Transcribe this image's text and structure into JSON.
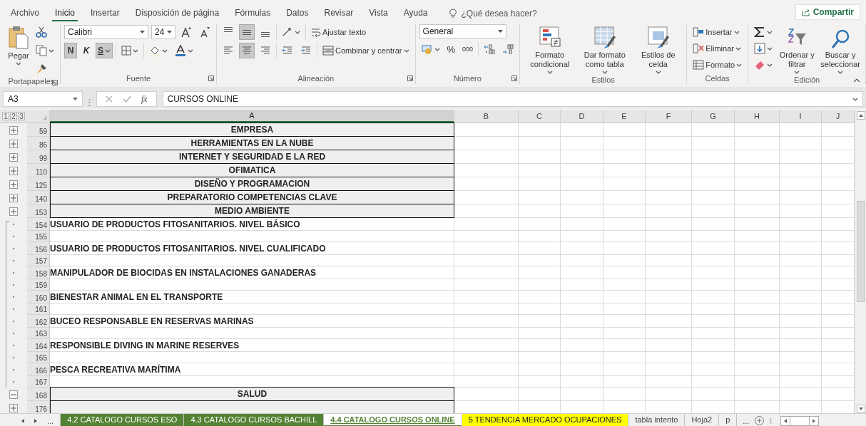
{
  "menu_tabs": [
    {
      "label": "Archivo",
      "selected": false
    },
    {
      "label": "Inicio",
      "selected": true
    },
    {
      "label": "Insertar",
      "selected": false
    },
    {
      "label": "Disposición de página",
      "selected": false
    },
    {
      "label": "Fórmulas",
      "selected": false
    },
    {
      "label": "Datos",
      "selected": false
    },
    {
      "label": "Revisar",
      "selected": false
    },
    {
      "label": "Vista",
      "selected": false
    },
    {
      "label": "Ayuda",
      "selected": false
    }
  ],
  "tell_me": {
    "placeholder": "¿Qué desea hacer?"
  },
  "share_button": "Compartir",
  "ribbon": {
    "clipboard": {
      "label": "Portapapeles",
      "paste": "Pegar"
    },
    "font": {
      "label": "Fuente",
      "font_name": "Calibri",
      "font_size": "24",
      "bold_key": "N",
      "italic_key": "K",
      "underline_key": "S",
      "bold": true,
      "italic": false,
      "underline": true
    },
    "alignment": {
      "label": "Alineación",
      "wrap_text": "Ajustar texto",
      "merge_center": "Combinar y centrar",
      "vertical": [
        {
          "selected": false
        },
        {
          "selected": true
        },
        {
          "selected": false
        }
      ],
      "horizontal": [
        {
          "selected": false
        },
        {
          "selected": true
        },
        {
          "selected": false
        }
      ]
    },
    "number": {
      "label": "Número",
      "format": "General",
      "percent": "%",
      "thousands": "000"
    },
    "styles": {
      "label": "Estilos",
      "buttons": [
        "Formato condicional",
        "Dar formato como tabla",
        "Estilos de celda"
      ]
    },
    "cells": {
      "label": "Celdas",
      "buttons": [
        "Insertar",
        "Eliminar",
        "Formato"
      ]
    },
    "editing": {
      "label": "Edición",
      "buttons": [
        "Ordenar y filtrar",
        "Buscar y seleccionar"
      ]
    }
  },
  "formula_bar": {
    "name_box": "A3",
    "function_symbol": "fx",
    "formula": "CURSOS ONLINE"
  },
  "outline_levels": [
    "1",
    "2",
    "3"
  ],
  "columns": [
    {
      "label": "A",
      "selected": true
    },
    {
      "label": "B",
      "selected": false
    },
    {
      "label": "C",
      "selected": false
    },
    {
      "label": "D",
      "selected": false
    },
    {
      "label": "E",
      "selected": false
    },
    {
      "label": "F",
      "selected": false
    },
    {
      "label": "G",
      "selected": false
    },
    {
      "label": "H",
      "selected": false
    },
    {
      "label": "I",
      "selected": false
    },
    {
      "label": "J",
      "selected": false
    }
  ],
  "rows": [
    {
      "number": "59",
      "kind": "heading",
      "collapsed": true,
      "text": "EMPRESA"
    },
    {
      "number": "86",
      "kind": "heading",
      "collapsed": true,
      "text": "HERRAMIENTAS EN LA NUBE"
    },
    {
      "number": "99",
      "kind": "heading",
      "collapsed": true,
      "text": "INTERNET Y SEGURIDAD E LA RED"
    },
    {
      "number": "110",
      "kind": "heading",
      "collapsed": true,
      "text": "OFIMATICA"
    },
    {
      "number": "125",
      "kind": "heading",
      "collapsed": true,
      "text": "DISEÑO Y PROGRAMACION"
    },
    {
      "number": "140",
      "kind": "heading",
      "collapsed": true,
      "text": "PREPARATORIO COMPETENCIAS CLAVE"
    },
    {
      "number": "153",
      "kind": "heading",
      "collapsed": true,
      "text": "MEDIO AMBIENTE"
    },
    {
      "number": "154",
      "kind": "item",
      "text": "USUARIO DE PRODUCTOS FITOSANITARIOS. NIVEL BÁSICO"
    },
    {
      "number": "155",
      "kind": "blank"
    },
    {
      "number": "156",
      "kind": "item",
      "text": "USUARIO DE PRODUCTOS FITOSANITARIOS. NIVEL CUALIFICADO"
    },
    {
      "number": "157",
      "kind": "blank"
    },
    {
      "number": "158",
      "kind": "item",
      "text": "MANIPULADOR DE BIOCIDAS EN INSTALACIONES GANADERAS"
    },
    {
      "number": "159",
      "kind": "blank"
    },
    {
      "number": "160",
      "kind": "item",
      "text": "BIENESTAR ANIMAL EN EL TRANSPORTE"
    },
    {
      "number": "161",
      "kind": "blank"
    },
    {
      "number": "162",
      "kind": "item",
      "text": "BUCEO RESPONSABLE EN RESERVAS MARINAS"
    },
    {
      "number": "163",
      "kind": "blank"
    },
    {
      "number": "164",
      "kind": "item",
      "text": "RESPONSIBLE DIVING IN MARINE RESERVES"
    },
    {
      "number": "165",
      "kind": "blank"
    },
    {
      "number": "166",
      "kind": "item",
      "text": "PESCA RECREATIVA MARÍTIMA"
    },
    {
      "number": "167",
      "kind": "blank"
    },
    {
      "number": "168",
      "kind": "heading",
      "collapsed": false,
      "text": "SALUD"
    },
    {
      "number": "176",
      "kind": "heading",
      "collapsed": true
    }
  ],
  "sheet_tabs": {
    "overflow_left": "...",
    "overflow_right": "...",
    "tabs": [
      {
        "label": "4.2 CATALOGO CURSOS ESO",
        "color": "#548235",
        "selected": false
      },
      {
        "label": "4.3 CATALOGO CURSOS BACHILL",
        "color": "#548235",
        "selected": false
      },
      {
        "label": "4.4 CATALOGO CURSOS ONLINE",
        "color": "#548235",
        "selected": true
      },
      {
        "label": "5 TENDENCIA MERCADO OCUPACIONES",
        "color": "#ffff00",
        "selected": false
      },
      {
        "label": "tabla intento",
        "selected": false
      },
      {
        "label": "Hoja2",
        "selected": false
      },
      {
        "label": "p",
        "selected": false
      }
    ]
  }
}
